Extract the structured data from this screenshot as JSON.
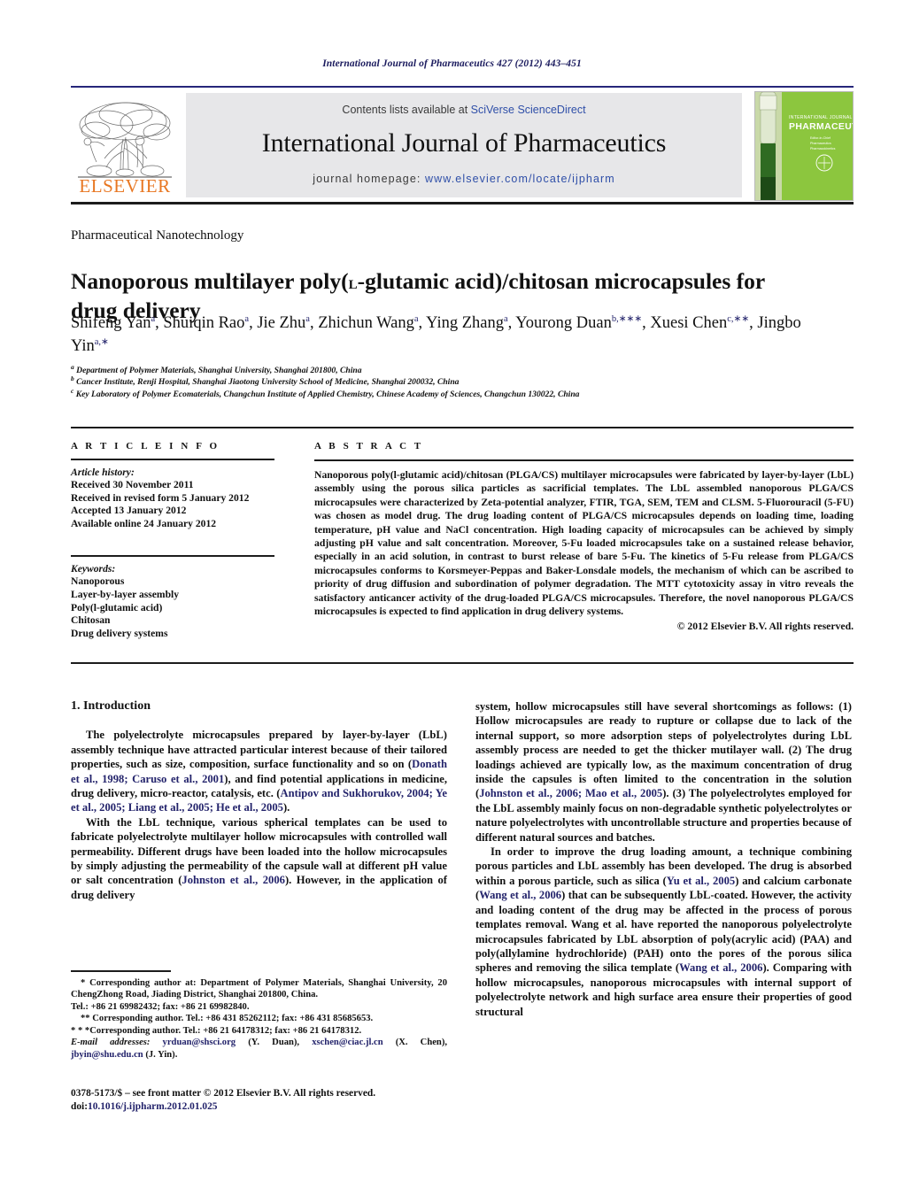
{
  "running_head": "International Journal of Pharmaceutics 427 (2012) 443–451",
  "masthead": {
    "contents_prefix": "Contents lists available at ",
    "sciencedirect_link": "SciVerse ScienceDirect",
    "journal_title": "International Journal of Pharmaceutics",
    "homepage_prefix": "journal homepage:",
    "homepage_url": "www.elsevier.com/locate/ijpharm",
    "publisher_wordmark": "ELSEVIER",
    "cover_title_small": "INTERNATIONAL JOURNAL OF",
    "cover_title_main": "PHARMACEUTICS",
    "cover_color": "#8cc63e",
    "link_color": "#2f4fa8"
  },
  "section_label": "Pharmaceutical Nanotechnology",
  "title": {
    "part1": "Nanoporous multilayer poly(",
    "smallcaps": "l",
    "part2": "-glutamic acid)/chitosan microcapsules for drug delivery"
  },
  "authors": [
    {
      "name": "Shifeng Yan",
      "sup": "a",
      "sep": ", "
    },
    {
      "name": "Shuiqin Rao",
      "sup": "a",
      "sep": ", "
    },
    {
      "name": "Jie Zhu",
      "sup": "a",
      "sep": ", "
    },
    {
      "name": "Zhichun Wang",
      "sup": "a",
      "sep": ", "
    },
    {
      "name": "Ying Zhang",
      "sup": "a",
      "sep": ", "
    },
    {
      "name": "Yourong Duan",
      "sup": "b,∗∗∗",
      "sep": ", "
    },
    {
      "name": "Xuesi Chen",
      "sup": "c,∗∗",
      "sep": ", "
    },
    {
      "name": "Jingbo Yin",
      "sup": "a,∗",
      "sep": ""
    }
  ],
  "affiliations": [
    {
      "marker": "a",
      "text": "Department of Polymer Materials, Shanghai University, Shanghai 201800, China"
    },
    {
      "marker": "b",
      "text": "Cancer Institute, Renji Hospital, Shanghai Jiaotong University School of Medicine, Shanghai 200032, China"
    },
    {
      "marker": "c",
      "text": "Key Laboratory of Polymer Ecomaterials, Changchun Institute of Applied Chemistry, Chinese Academy of Sciences, Changchun 130022, China"
    }
  ],
  "article_info": {
    "heading": "A R T I C L E  I N F O",
    "history_label": "Article history:",
    "history": [
      "Received 30 November 2011",
      "Received in revised form 5 January 2012",
      "Accepted 13 January 2012",
      "Available online 24 January 2012"
    ],
    "keywords_label": "Keywords:",
    "keywords": [
      "Nanoporous",
      "Layer-by-layer assembly",
      "Poly(l-glutamic acid)",
      "Chitosan",
      "Drug delivery systems"
    ]
  },
  "abstract": {
    "heading": "A B S T R A C T",
    "body": "Nanoporous poly(l-glutamic acid)/chitosan (PLGA/CS) multilayer microcapsules were fabricated by layer-by-layer (LbL) assembly using the porous silica particles as sacrificial templates. The LbL assembled nanoporous PLGA/CS microcapsules were characterized by Zeta-potential analyzer, FTIR, TGA, SEM, TEM and CLSM. 5-Fluorouracil (5-FU) was chosen as model drug. The drug loading content of PLGA/CS microcapsules depends on loading time, loading temperature, pH value and NaCl concentration. High loading capacity of microcapsules can be achieved by simply adjusting pH value and salt concentration. Moreover, 5-Fu loaded microcapsules take on a sustained release behavior, especially in an acid solution, in contrast to burst release of bare 5-Fu. The kinetics of 5-Fu release from PLGA/CS microcapsules conforms to Korsmeyer-Peppas and Baker-Lonsdale models, the mechanism of which can be ascribed to priority of drug diffusion and subordination of polymer degradation. The MTT cytotoxicity assay in vitro reveals the satisfactory anticancer activity of the drug-loaded PLGA/CS microcapsules. Therefore, the novel nanoporous PLGA/CS microcapsules is expected to find application in drug delivery systems.",
    "copyright": "© 2012 Elsevier B.V. All rights reserved."
  },
  "introduction": {
    "heading": "1.  Introduction",
    "left_paragraphs": [
      {
        "segments": [
          {
            "t": "The polyelectrolyte microcapsules prepared by layer-by-layer (LbL) assembly technique have attracted particular interest because of their tailored properties, such as size, composition, surface functionality and so on (",
            "c": false
          },
          {
            "t": "Donath et al., 1998; Caruso et al., 2001",
            "c": true
          },
          {
            "t": "), and find potential applications in medicine, drug delivery, micro-reactor, catalysis, etc. (",
            "c": false
          },
          {
            "t": "Antipov and Sukhorukov, 2004; Ye et al., 2005; Liang et al., 2005; He et al., 2005",
            "c": true
          },
          {
            "t": ").",
            "c": false
          }
        ]
      },
      {
        "segments": [
          {
            "t": "With the LbL technique, various spherical templates can be used to fabricate polyelectrolyte multilayer hollow microcapsules with controlled wall permeability. Different drugs have been loaded into the hollow microcapsules by simply adjusting the permeability of the capsule wall at different pH value or salt concentration (",
            "c": false
          },
          {
            "t": "Johnston et al., 2006",
            "c": true
          },
          {
            "t": "). However, in the application of drug delivery",
            "c": false
          }
        ]
      }
    ],
    "right_paragraphs": [
      {
        "cont": true,
        "segments": [
          {
            "t": "system, hollow microcapsules still have several shortcomings as follows: (1) Hollow microcapsules are ready to rupture or collapse due to lack of the internal support, so more adsorption steps of polyelectrolytes during LbL assembly process are needed to get the thicker mutilayer wall. (2) The drug loadings achieved are typically low, as the maximum concentration of drug inside the capsules is often limited to the concentration in the solution (",
            "c": false
          },
          {
            "t": "Johnston et al., 2006; Mao et al., 2005",
            "c": true
          },
          {
            "t": "). (3) The polyelectrolytes employed for the LbL assembly mainly focus on non-degradable synthetic polyelectrolytes or nature polyelectrolytes with uncontrollable structure and properties because of different natural sources and batches.",
            "c": false
          }
        ]
      },
      {
        "cont": false,
        "segments": [
          {
            "t": "In order to improve the drug loading amount, a technique combining porous particles and LbL assembly has been developed. The drug is absorbed within a porous particle, such as silica (",
            "c": false
          },
          {
            "t": "Yu et al., 2005",
            "c": true
          },
          {
            "t": ") and calcium carbonate (",
            "c": false
          },
          {
            "t": "Wang et al., 2006",
            "c": true
          },
          {
            "t": ") that can be subsequently LbL-coated. However, the activity and loading content of the drug may be affected in the process of porous templates removal. Wang et al. have reported the nanoporous polyelectrolyte microcapsules fabricated by LbL absorption of poly(acrylic acid) (PAA) and poly(allylamine hydrochloride) (PAH) onto the pores of the porous silica spheres and removing the silica template (",
            "c": false
          },
          {
            "t": "Wang et al., 2006",
            "c": true
          },
          {
            "t": "). Comparing with hollow microcapsules, nanoporous microcapsules with internal support of polyelectrolyte network and high surface area ensure their properties of good structural",
            "c": false
          }
        ]
      }
    ]
  },
  "footnotes": {
    "corresponding_1": "* Corresponding author at: Department of Polymer Materials, Shanghai University, 20 ChengZhong Road, Jiading District, Shanghai 201800, China.",
    "corresponding_1_tel": "Tel.: +86 21 69982432; fax: +86 21 69982840.",
    "corresponding_2": "** Corresponding author. Tel.: +86 431 85262112; fax: +86 431 85685653.",
    "corresponding_3": "* * *Corresponding author. Tel.: +86 21 64178312; fax: +86 21 64178312.",
    "email_label": "E-mail addresses:",
    "emails": [
      {
        "address": "yrduan@shsci.org",
        "owner": " (Y. Duan), "
      },
      {
        "address": "xschen@ciac.jl.cn",
        "owner": " (X. Chen), "
      },
      {
        "address": "jbyin@shu.edu.cn",
        "owner": " (J. Yin)."
      }
    ]
  },
  "footer": {
    "issn_line": "0378-5173/$ – see front matter © 2012 Elsevier B.V. All rights reserved.",
    "doi_prefix": "doi:",
    "doi_value": "10.1016/j.ijpharm.2012.01.025"
  }
}
